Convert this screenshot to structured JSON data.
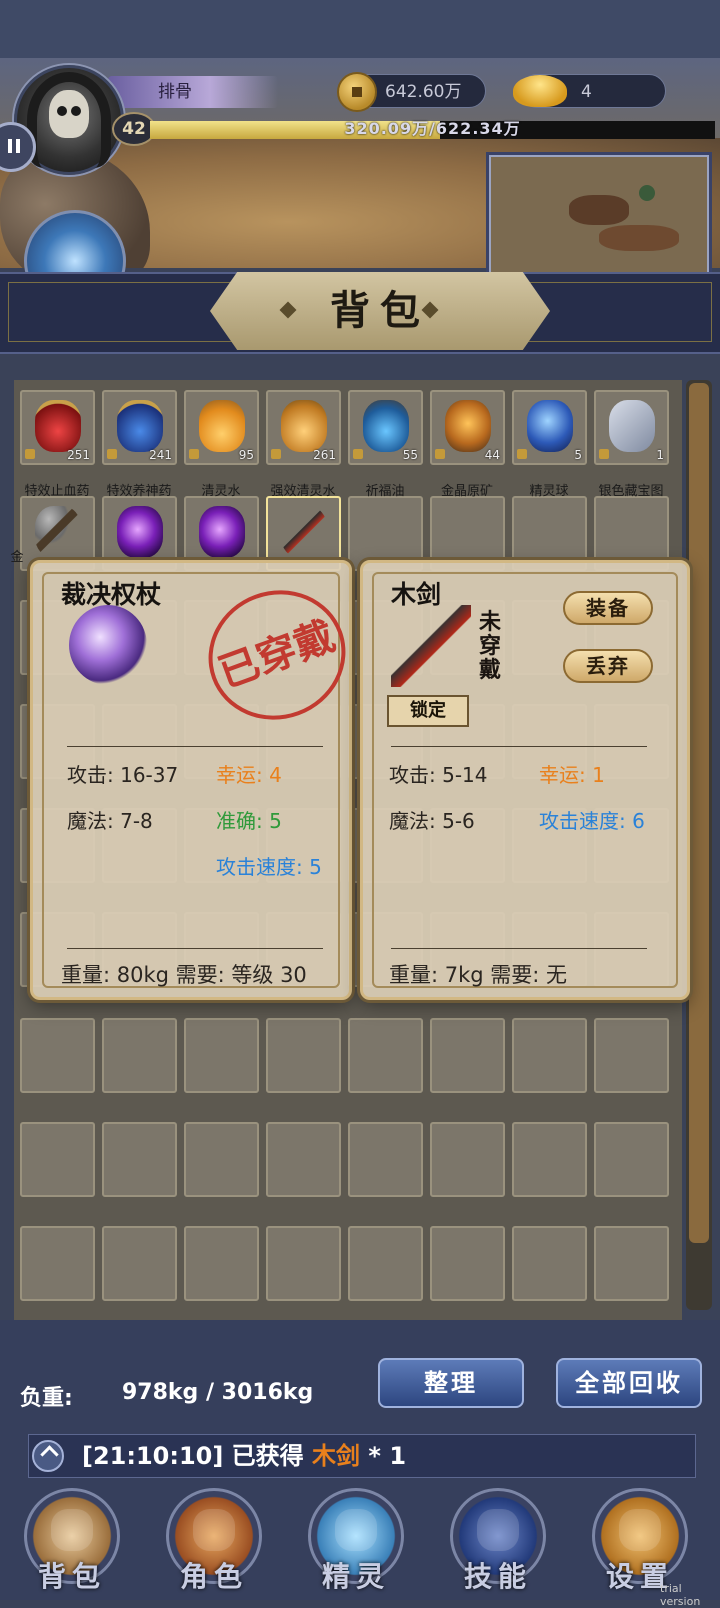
{
  "player": {
    "name": "排骨",
    "level": "42",
    "exp_text": "320.09万/622.34万",
    "exp_progress": 0.514
  },
  "currency": {
    "coins": "642.60万",
    "ingots": "4"
  },
  "bag": {
    "title": "背包"
  },
  "inventory": {
    "row1": [
      {
        "label": "特效止血药",
        "qty": "251",
        "icon": "red-potion-icon"
      },
      {
        "label": "特效养神药",
        "qty": "241",
        "icon": "blue-potion-icon"
      },
      {
        "label": "清灵水",
        "qty": "95",
        "icon": "orange-flask-icon"
      },
      {
        "label": "强效清灵水",
        "qty": "261",
        "icon": "gold-jar-icon"
      },
      {
        "label": "祈福油",
        "qty": "55",
        "icon": "oil-jar-icon"
      },
      {
        "label": "金晶原矿",
        "qty": "44",
        "icon": "ore-icon"
      },
      {
        "label": "精灵球",
        "qty": "5",
        "icon": "spirit-orb-icon"
      },
      {
        "label": "银色藏宝图",
        "qty": "1",
        "icon": "treasure-map-icon"
      }
    ],
    "row2_partial_label": "金"
  },
  "card_left": {
    "title": "裁决权杖",
    "stamp": "已穿戴",
    "attack_label": "攻击: 16-37",
    "luck_label": "幸运: 4",
    "magic_label": "魔法: 7-8",
    "accuracy_label": "准确: 5",
    "speed_label": "攻击速度: 5",
    "footer": "重量: 80kg 需要: 等级  30"
  },
  "card_right": {
    "title": "木剑",
    "status": "未穿戴",
    "equip_button": "装备",
    "discard_button": "丢弃",
    "lock_button": "锁定",
    "attack_label": "攻击: 5-14",
    "luck_label": "幸运: 1",
    "magic_label": "魔法: 5-6",
    "speed_label": "攻击速度: 6",
    "footer": "重量: 7kg   需要: 无"
  },
  "bottom": {
    "weight_label": "负重:",
    "weight_value": "978kg / 3016kg",
    "sort_button": "整理",
    "recycle_button": "全部回收",
    "log_prefix": "[21:10:10] 已获得",
    "log_item": "木剑",
    "log_suffix": " * 1"
  },
  "nav": [
    {
      "label": "背包",
      "icon": "bag-icon"
    },
    {
      "label": "角色",
      "icon": "character-icon"
    },
    {
      "label": "精灵",
      "icon": "spirit-egg-icon"
    },
    {
      "label": "技能",
      "icon": "skill-book-icon"
    },
    {
      "label": "设置",
      "icon": "settings-icon"
    }
  ],
  "watermark": "trial version",
  "colors": {
    "accent_orange": "#e9801c",
    "accent_green": "#2f9a3a",
    "accent_blue": "#2a82d8",
    "stamp_red": "#c23a30"
  }
}
